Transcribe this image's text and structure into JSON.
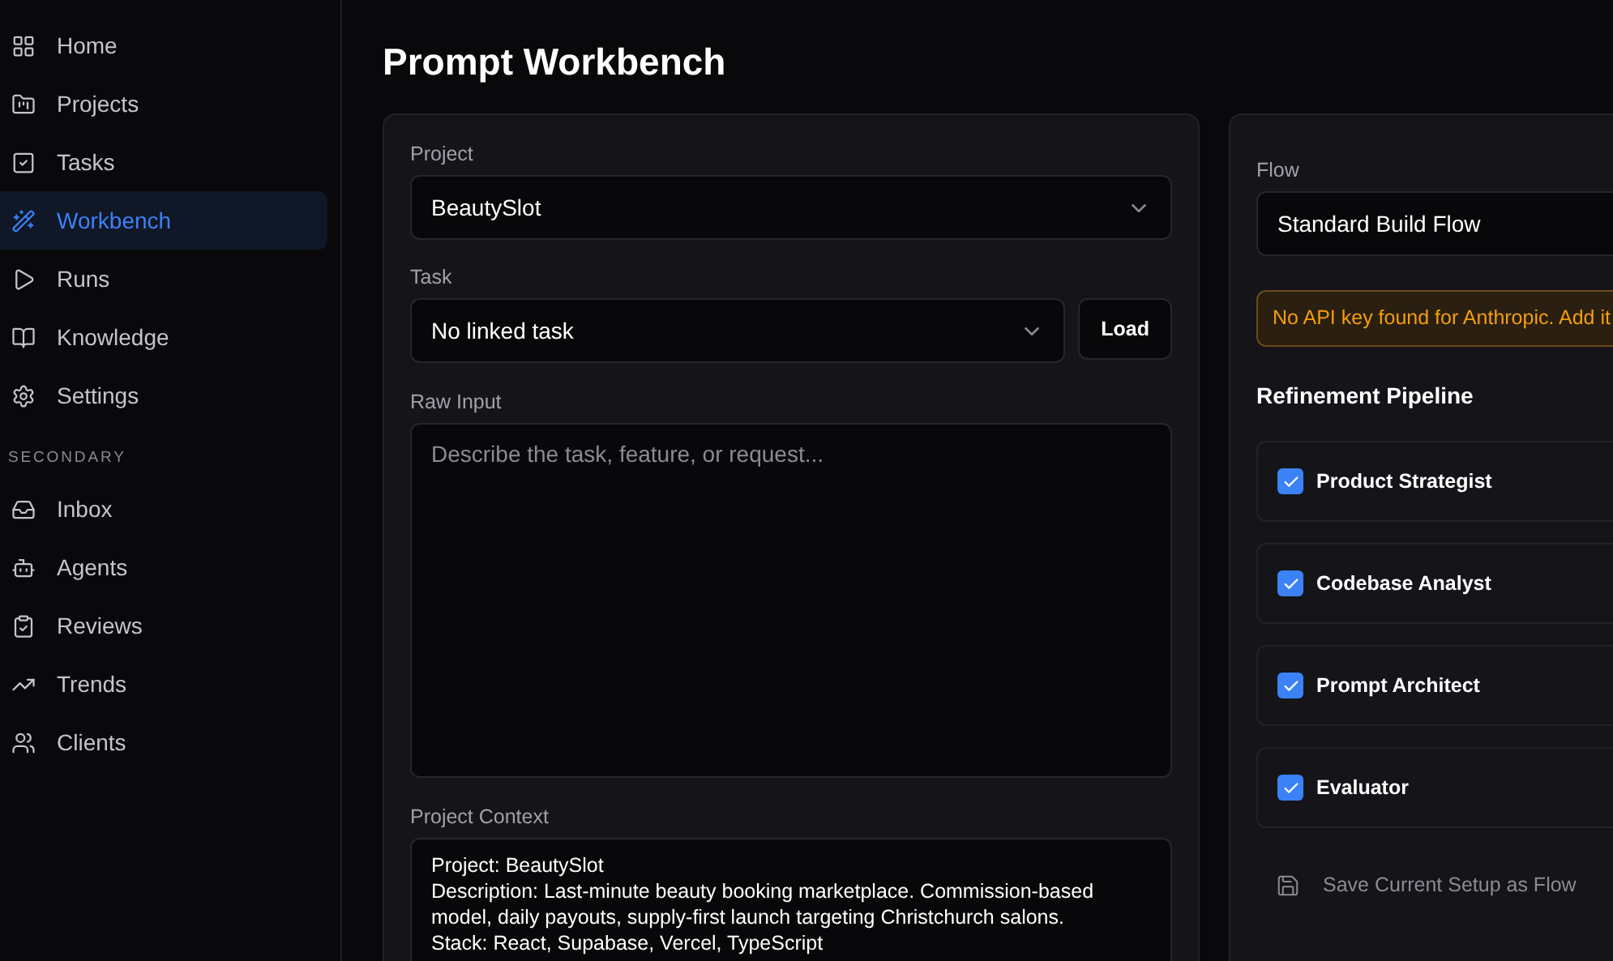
{
  "sidebar": {
    "items": [
      {
        "label": "Home",
        "selected": false
      },
      {
        "label": "Projects",
        "selected": false
      },
      {
        "label": "Tasks",
        "selected": false
      },
      {
        "label": "Workbench",
        "selected": true
      },
      {
        "label": "Runs",
        "selected": false
      },
      {
        "label": "Knowledge",
        "selected": false
      },
      {
        "label": "Settings",
        "selected": false
      }
    ],
    "section_label": "SECONDARY",
    "secondary_items": [
      {
        "label": "Inbox",
        "selected": false
      },
      {
        "label": "Agents",
        "selected": false
      },
      {
        "label": "Reviews",
        "selected": false
      },
      {
        "label": "Trends",
        "selected": false
      },
      {
        "label": "Clients",
        "selected": false
      }
    ]
  },
  "page_title": "Prompt Workbench",
  "form": {
    "project": {
      "label": "Project",
      "value": "BeautySlot"
    },
    "task": {
      "label": "Task",
      "value": "No linked task",
      "button": "Load"
    },
    "raw_input": {
      "label": "Raw Input",
      "placeholder": "Describe the task, feature, or request..."
    },
    "project_context": {
      "label": "Project Context",
      "value": "Project: BeautySlot\nDescription: Last-minute beauty booking marketplace. Commission-based model, daily payouts, supply-first launch targeting Christchurch salons.\nStack: React, Supabase, Vercel, TypeScript"
    }
  },
  "settings": {
    "flow": {
      "label": "Flow",
      "value": "Standard Build Flow"
    },
    "warning": "No API key found for Anthropic. Add it",
    "pipeline_title": "Refinement Pipeline",
    "pipeline": [
      {
        "label": "Product Strategist",
        "checked": true
      },
      {
        "label": "Codebase Analyst",
        "checked": true
      },
      {
        "label": "Prompt Architect",
        "checked": true
      },
      {
        "label": "Evaluator",
        "checked": true
      }
    ],
    "save_button": "Save Current Setup as Flow"
  }
}
